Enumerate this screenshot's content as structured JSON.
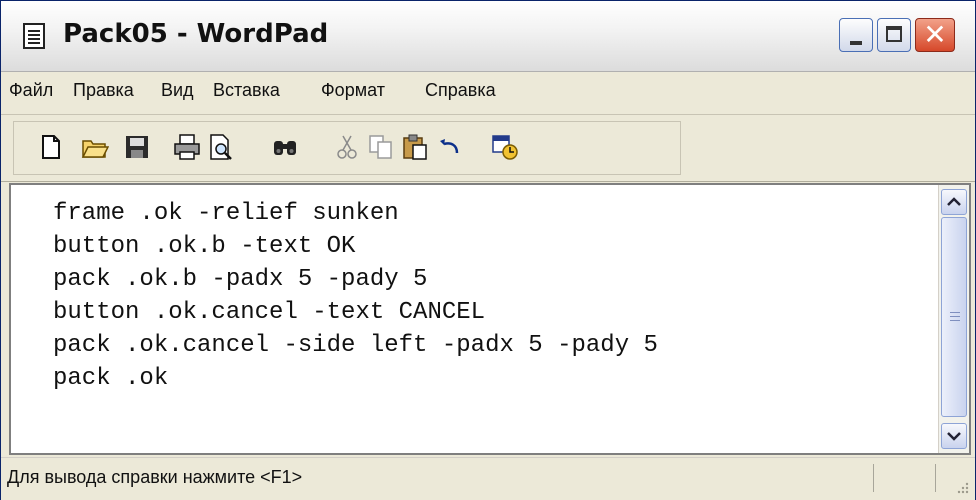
{
  "window": {
    "title": "Pack05 - WordPad",
    "icons": {
      "app": "document-icon",
      "minimize": "minimize-icon",
      "maximize": "maximize-icon",
      "close": "close-icon"
    },
    "close_glyph": "✕"
  },
  "menu": {
    "items": [
      "Файл",
      "Правка",
      "Вид",
      "Вставка",
      "Формат",
      "Справка"
    ]
  },
  "toolbar": {
    "buttons": [
      "new-document-icon",
      "open-folder-icon",
      "save-icon",
      "print-icon",
      "print-preview-icon",
      "find-icon",
      "cut-icon",
      "copy-icon",
      "paste-icon",
      "undo-icon",
      "insert-date-time-icon"
    ]
  },
  "document": {
    "lines": [
      "frame .ok -relief sunken",
      "button .ok.b -text OK",
      "pack .ok.b -padx 5 -pady 5",
      "button .ok.cancel -text CANCEL",
      "pack .ok.cancel -side left -padx 5 -pady 5",
      "pack .ok"
    ]
  },
  "status": {
    "text": "Для вывода справки нажмите <F1>"
  },
  "colors": {
    "chrome": "#ece9d8",
    "close_button": "#d6482a",
    "text": "#111111"
  }
}
